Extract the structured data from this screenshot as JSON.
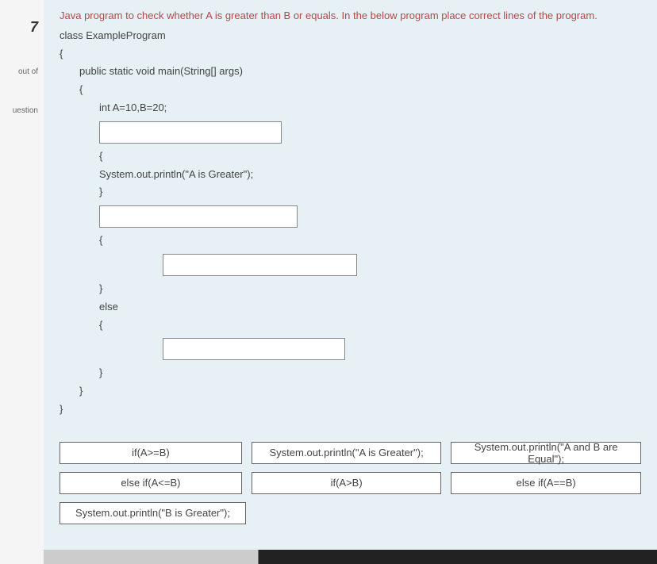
{
  "sidebar": {
    "number": "7",
    "blank1": "",
    "out_of": "out of",
    "flag": "uestion"
  },
  "question": {
    "prompt": "Java program to check whether A is greater than B or equals. In the below program place correct lines of the program.",
    "lines": {
      "l1": "class ExampleProgram",
      "l2": "{",
      "l3": "public static void main(String[] args)",
      "l4": "{",
      "l5": "int A=10,B=20;",
      "l6": "{",
      "l7": "System.out.println(\"A is Greater\");",
      "l8": "}",
      "l9": "{",
      "l10": "}",
      "l11": "else",
      "l12": "{",
      "l13": "}",
      "l14": "}",
      "l15": "}"
    }
  },
  "options": {
    "o1": "if(A>=B)",
    "o2": "System.out.println(\"A is Greater\");",
    "o3": "System.out.println(\"A and B are Equal\");",
    "o4": "else if(A<=B)",
    "o5": "if(A>B)",
    "o6": "else if(A==B)",
    "o7": "System.out.println(\"B is Greater\");"
  }
}
